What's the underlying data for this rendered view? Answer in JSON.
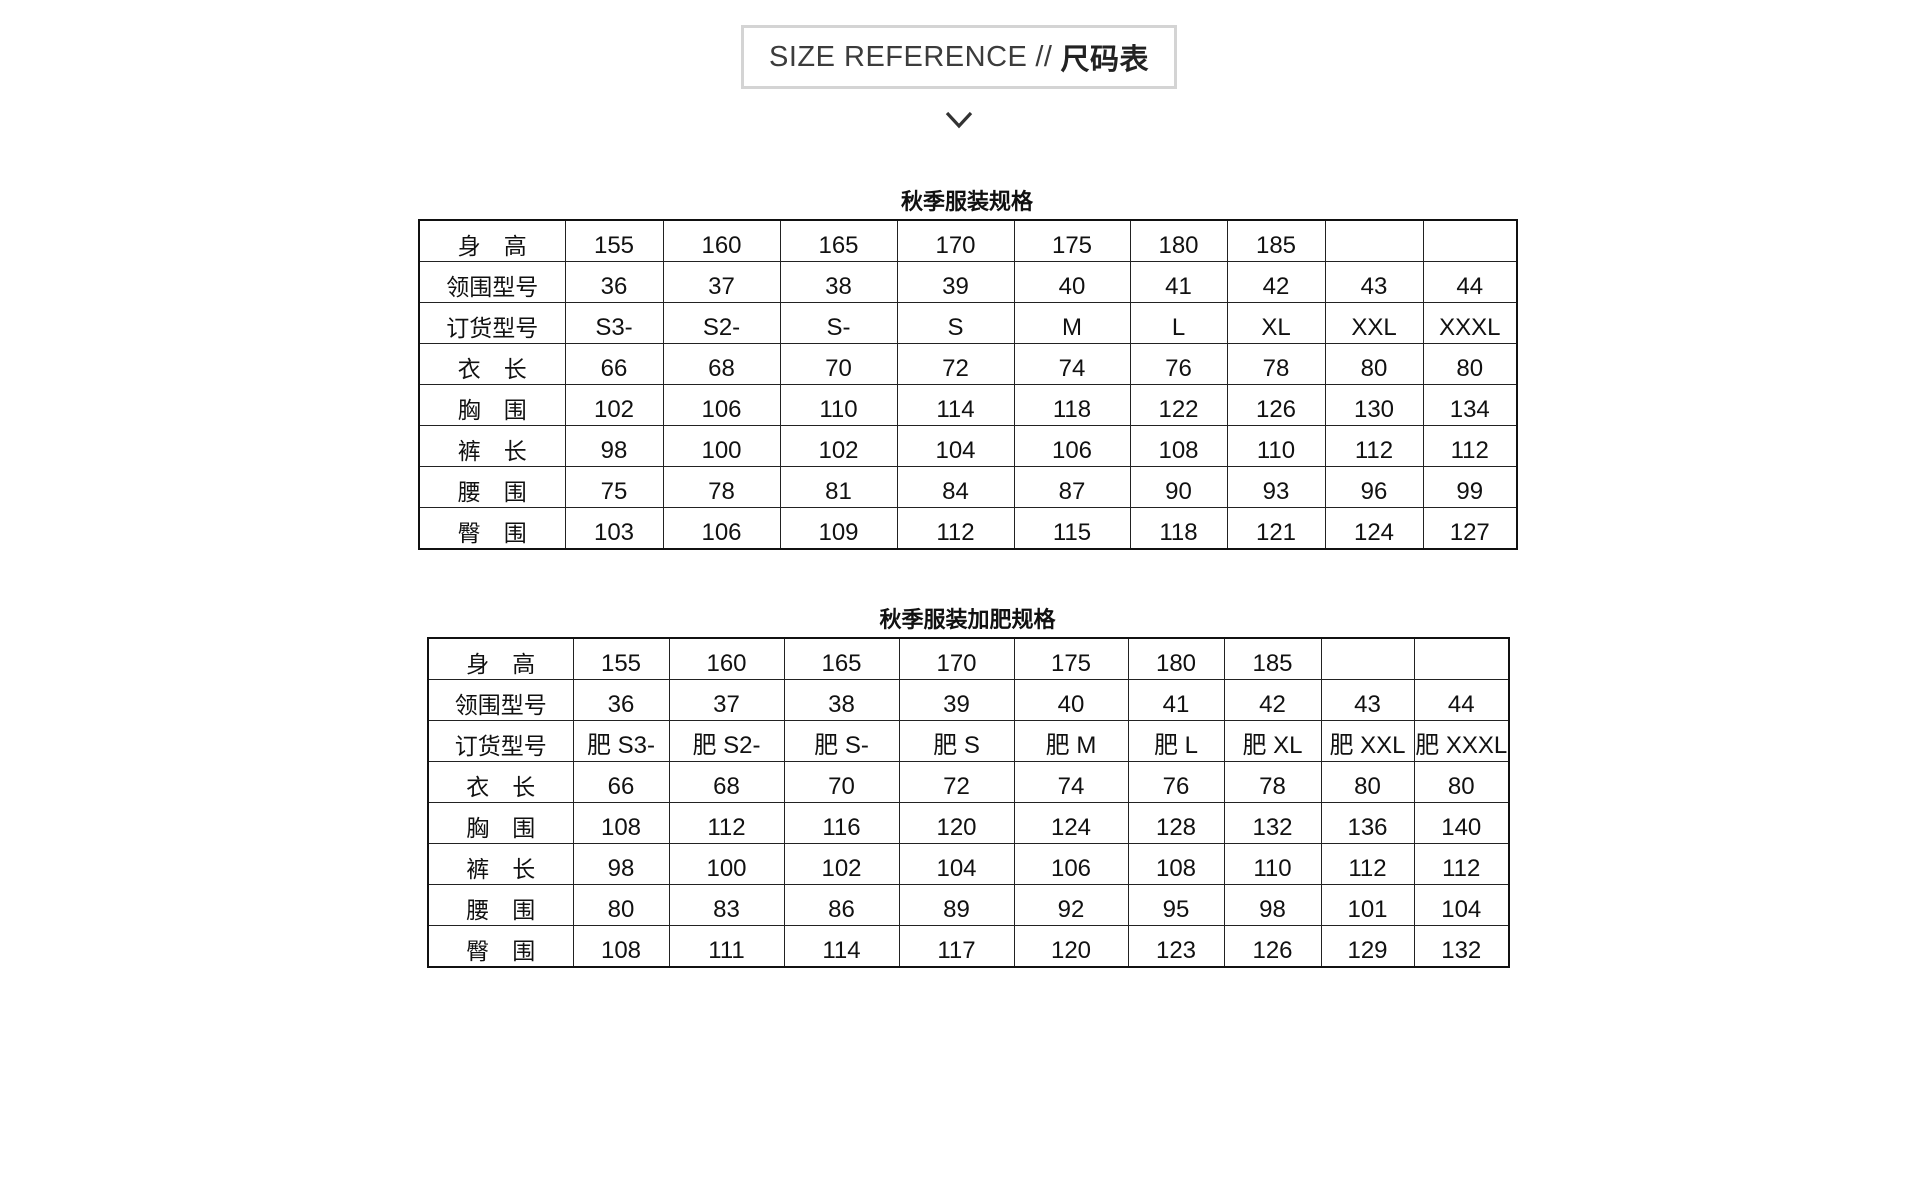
{
  "header": {
    "title_en": "SIZE REFERENCE",
    "separator": "//",
    "title_cn": "尺码表"
  },
  "icons": {
    "chevron": "chevron-down-icon"
  },
  "tables": [
    {
      "title": "秋季服装规格",
      "rows": [
        [
          "身　高",
          "155",
          "160",
          "165",
          "170",
          "175",
          "180",
          "185",
          "",
          ""
        ],
        [
          "领围型号",
          "36",
          "37",
          "38",
          "39",
          "40",
          "41",
          "42",
          "43",
          "44"
        ],
        [
          "订货型号",
          "S3-",
          "S2-",
          "S-",
          "S",
          "M",
          "L",
          "XL",
          "XXL",
          "XXXL"
        ],
        [
          "衣　长",
          "66",
          "68",
          "70",
          "72",
          "74",
          "76",
          "78",
          "80",
          "80"
        ],
        [
          "胸　围",
          "102",
          "106",
          "110",
          "114",
          "118",
          "122",
          "126",
          "130",
          "134"
        ],
        [
          "裤　长",
          "98",
          "100",
          "102",
          "104",
          "106",
          "108",
          "110",
          "112",
          "112"
        ],
        [
          "腰　围",
          "75",
          "78",
          "81",
          "84",
          "87",
          "90",
          "93",
          "96",
          "99"
        ],
        [
          "臀　围",
          "103",
          "106",
          "109",
          "112",
          "115",
          "118",
          "121",
          "124",
          "127"
        ]
      ]
    },
    {
      "title": "秋季服装加肥规格",
      "rows": [
        [
          "身　高",
          "155",
          "160",
          "165",
          "170",
          "175",
          "180",
          "185",
          "",
          ""
        ],
        [
          "领围型号",
          "36",
          "37",
          "38",
          "39",
          "40",
          "41",
          "42",
          "43",
          "44"
        ],
        [
          "订货型号",
          "肥 S3-",
          "肥 S2-",
          "肥 S-",
          "肥 S",
          "肥 M",
          "肥 L",
          "肥 XL",
          "肥 XXL",
          "肥 XXXL"
        ],
        [
          "衣　长",
          "66",
          "68",
          "70",
          "72",
          "74",
          "76",
          "78",
          "80",
          "80"
        ],
        [
          "胸　围",
          "108",
          "112",
          "116",
          "120",
          "124",
          "128",
          "132",
          "136",
          "140"
        ],
        [
          "裤　长",
          "98",
          "100",
          "102",
          "104",
          "106",
          "108",
          "110",
          "112",
          "112"
        ],
        [
          "腰　围",
          "80",
          "83",
          "86",
          "89",
          "92",
          "95",
          "98",
          "101",
          "104"
        ],
        [
          "臀　围",
          "108",
          "111",
          "114",
          "117",
          "120",
          "123",
          "126",
          "129",
          "132"
        ]
      ]
    }
  ]
}
